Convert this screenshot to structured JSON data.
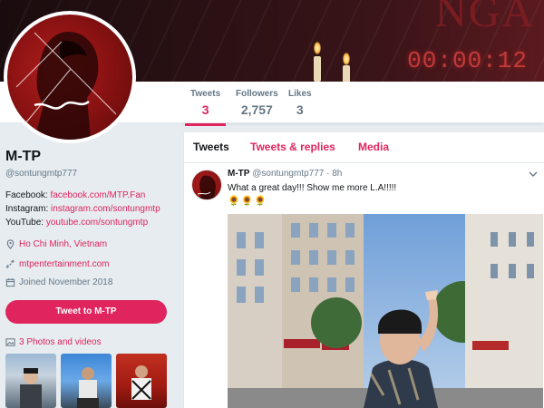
{
  "banner": {
    "title_text": "NGA",
    "clock_text": "00:00:12"
  },
  "stats": [
    {
      "label": "Tweets",
      "value": "3"
    },
    {
      "label": "Followers",
      "value": "2,757"
    },
    {
      "label": "Likes",
      "value": "3"
    }
  ],
  "profile": {
    "name": "M-TP",
    "handle": "@sontungmtp777",
    "bio": {
      "facebook_prefix": "Facebook: ",
      "facebook_link": "facebook.com/MTP.Fan",
      "instagram_prefix": "Instagram: ",
      "instagram_link": "instagram.com/sontungmtp",
      "youtube_prefix": "YouTube: ",
      "youtube_link": "youtube.com/sontungmtp"
    },
    "location": "Ho Chi Minh, Vietnam",
    "website": "mtpentertainment.com",
    "joined": "Joined November 2018",
    "tweet_to_label": "Tweet to M-TP",
    "photos_label": "3 Photos and videos"
  },
  "tabs": [
    {
      "label": "Tweets"
    },
    {
      "label": "Tweets & replies"
    },
    {
      "label": "Media"
    }
  ],
  "tweet": {
    "name": "M-TP",
    "handle_time": "@sontungmtp777 · 8h",
    "text": "What a great day!!! Show me more L.A!!!!!",
    "emojis": "🌻🌻🌻"
  },
  "icons": {
    "location": "location-pin-icon",
    "link": "link-icon",
    "calendar": "calendar-icon",
    "photos": "photo-icon",
    "caret": "chevron-down-icon"
  },
  "colors": {
    "accent": "#e0245e",
    "background": "#e6ecf0"
  }
}
